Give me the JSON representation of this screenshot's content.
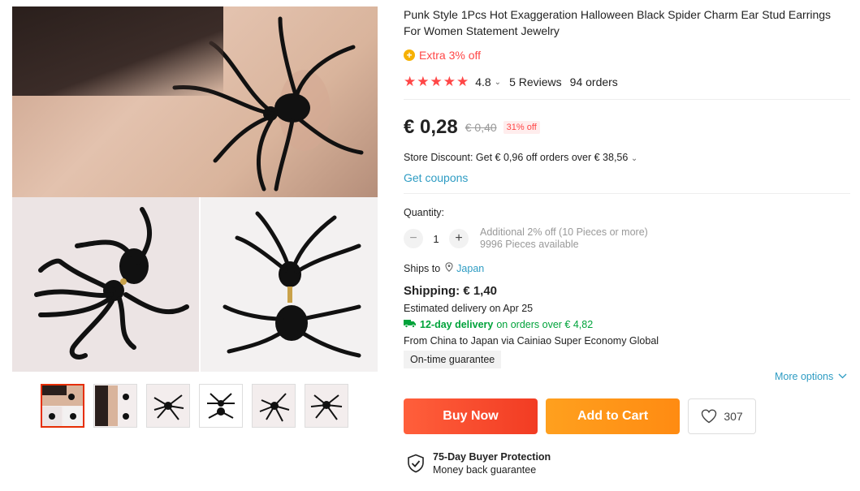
{
  "product": {
    "title": "Punk Style 1Pcs Hot Exaggeration Halloween Black Spider Charm Ear Stud Earrings For Women Statement Jewelry",
    "extra_discount": "Extra 3% off",
    "rating": "4.8",
    "stars": "★★★★★",
    "reviews": "5 Reviews",
    "orders": "94 orders"
  },
  "price": {
    "current": "€ 0,28",
    "original": "€ 0,40",
    "discount": "31% off"
  },
  "store_discount": "Store Discount: Get € 0,96 off orders over € 38,56",
  "get_coupons": "Get coupons",
  "quantity": {
    "label": "Quantity:",
    "value": "1",
    "minus": "−",
    "plus": "+",
    "additional": "Additional 2% off (10 Pieces or more)",
    "available": "9996 Pieces available"
  },
  "shipping": {
    "ships_to_label": "Ships to",
    "country": "Japan",
    "cost": "Shipping: € 1,40",
    "estimated": "Estimated delivery on Apr 25",
    "delivery_fast": "12-day delivery",
    "delivery_condition": "on orders over € 4,82",
    "from": "From China to Japan via Cainiao Super Economy Global",
    "guarantee": "On-time guarantee",
    "more_options": "More options"
  },
  "actions": {
    "buy_now": "Buy Now",
    "add_to_cart": "Add to Cart",
    "wishlist_count": "307"
  },
  "protection": {
    "title": "75-Day Buyer Protection",
    "subtitle": "Money back guarantee"
  },
  "colors": {
    "accent_red": "#ff4747",
    "link_blue": "#2e9cc3",
    "green": "#00a33b",
    "buy_gradient": "#f23c23",
    "cart_gradient": "#ff8b12"
  },
  "icons": [
    "plus-circle-icon",
    "star-icon",
    "chevron-down-icon",
    "location-pin-icon",
    "truck-icon",
    "heart-icon",
    "shield-check-icon"
  ]
}
